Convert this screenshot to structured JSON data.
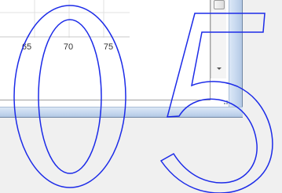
{
  "axis": {
    "tick_labels": [
      "65",
      "70",
      "75"
    ]
  },
  "overlay": {
    "digits": "05"
  },
  "colors": {
    "overlay_stroke": "#1c2be8",
    "frame": "#c6d8ef",
    "grid": "#e2e2e2"
  }
}
